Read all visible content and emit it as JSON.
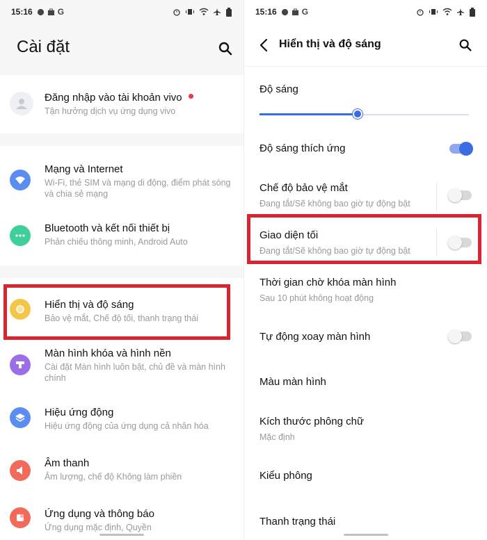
{
  "status": {
    "time": "15:16",
    "carrier_glyph": "G"
  },
  "left": {
    "title": "Cài đặt",
    "account": {
      "label": "Đăng nhập vào tài khoản vivo",
      "sub": "Tận hưởng dịch vụ ứng dụng vivo"
    },
    "items": [
      {
        "label": "Mạng và Internet",
        "sub": "Wi-Fi, thẻ SIM và mạng di động, điểm phát sóng và chia sẻ mạng",
        "color": "#5b8df0",
        "icon": "wifi-icon"
      },
      {
        "label": "Bluetooth và kết nối thiết bị",
        "sub": "Phản chiếu thông minh, Android Auto",
        "color": "#3ecf9a",
        "icon": "bluetooth-icon"
      },
      {
        "label": "Hiển thị và độ sáng",
        "sub": "Bảo vệ mắt, Chế độ tối, thanh trạng thái",
        "color": "#f3c64a",
        "icon": "brightness-icon"
      },
      {
        "label": "Màn hình khóa và hình nền",
        "sub": "Cài đặt Màn hình luôn bật, chủ đề và màn hình chính",
        "color": "#9a6ee6",
        "icon": "wallpaper-icon"
      },
      {
        "label": "Hiệu ứng động",
        "sub": "Hiệu ứng động của ứng dụng cả nhân hóa",
        "color": "#5b8df0",
        "icon": "layers-icon"
      },
      {
        "label": "Âm thanh",
        "sub": "Âm lượng, chế độ Không làm phiền",
        "color": "#f26a5a",
        "icon": "speaker-icon"
      },
      {
        "label": "Ứng dụng và thông báo",
        "sub": "Ứng dụng mặc định, Quyền",
        "color": "#f26a5a",
        "icon": "apps-icon"
      }
    ]
  },
  "right": {
    "title": "Hiển thị và độ sáng",
    "brightness_label": "Độ sáng",
    "brightness_level": 0.47,
    "items": [
      {
        "label": "Độ sáng thích ứng",
        "sub": "",
        "toggle": "on"
      },
      {
        "label": "Chế độ bảo vệ mắt",
        "sub": "Đang tắt/Sẽ không bao giờ tự động bật",
        "toggle": "off"
      },
      {
        "label": "Giao diện tối",
        "sub": "Đang tắt/Sẽ không bao giờ tự động bật",
        "toggle": "off"
      },
      {
        "label": "Thời gian chờ khóa màn hình",
        "sub": "Sau 10 phút không hoạt động",
        "toggle": ""
      },
      {
        "label": "Tự động xoay màn hình",
        "sub": "",
        "toggle": "off"
      },
      {
        "label": "Màu màn hình",
        "sub": "",
        "toggle": ""
      },
      {
        "label": "Kích thước phông chữ",
        "sub": "Mặc định",
        "toggle": ""
      },
      {
        "label": "Kiểu phông",
        "sub": "",
        "toggle": ""
      },
      {
        "label": "Thanh trạng thái",
        "sub": "",
        "toggle": ""
      }
    ]
  },
  "colors": {
    "accent": "#3c6be6",
    "highlight": "#d7262f",
    "badge": "#e53a4b"
  }
}
